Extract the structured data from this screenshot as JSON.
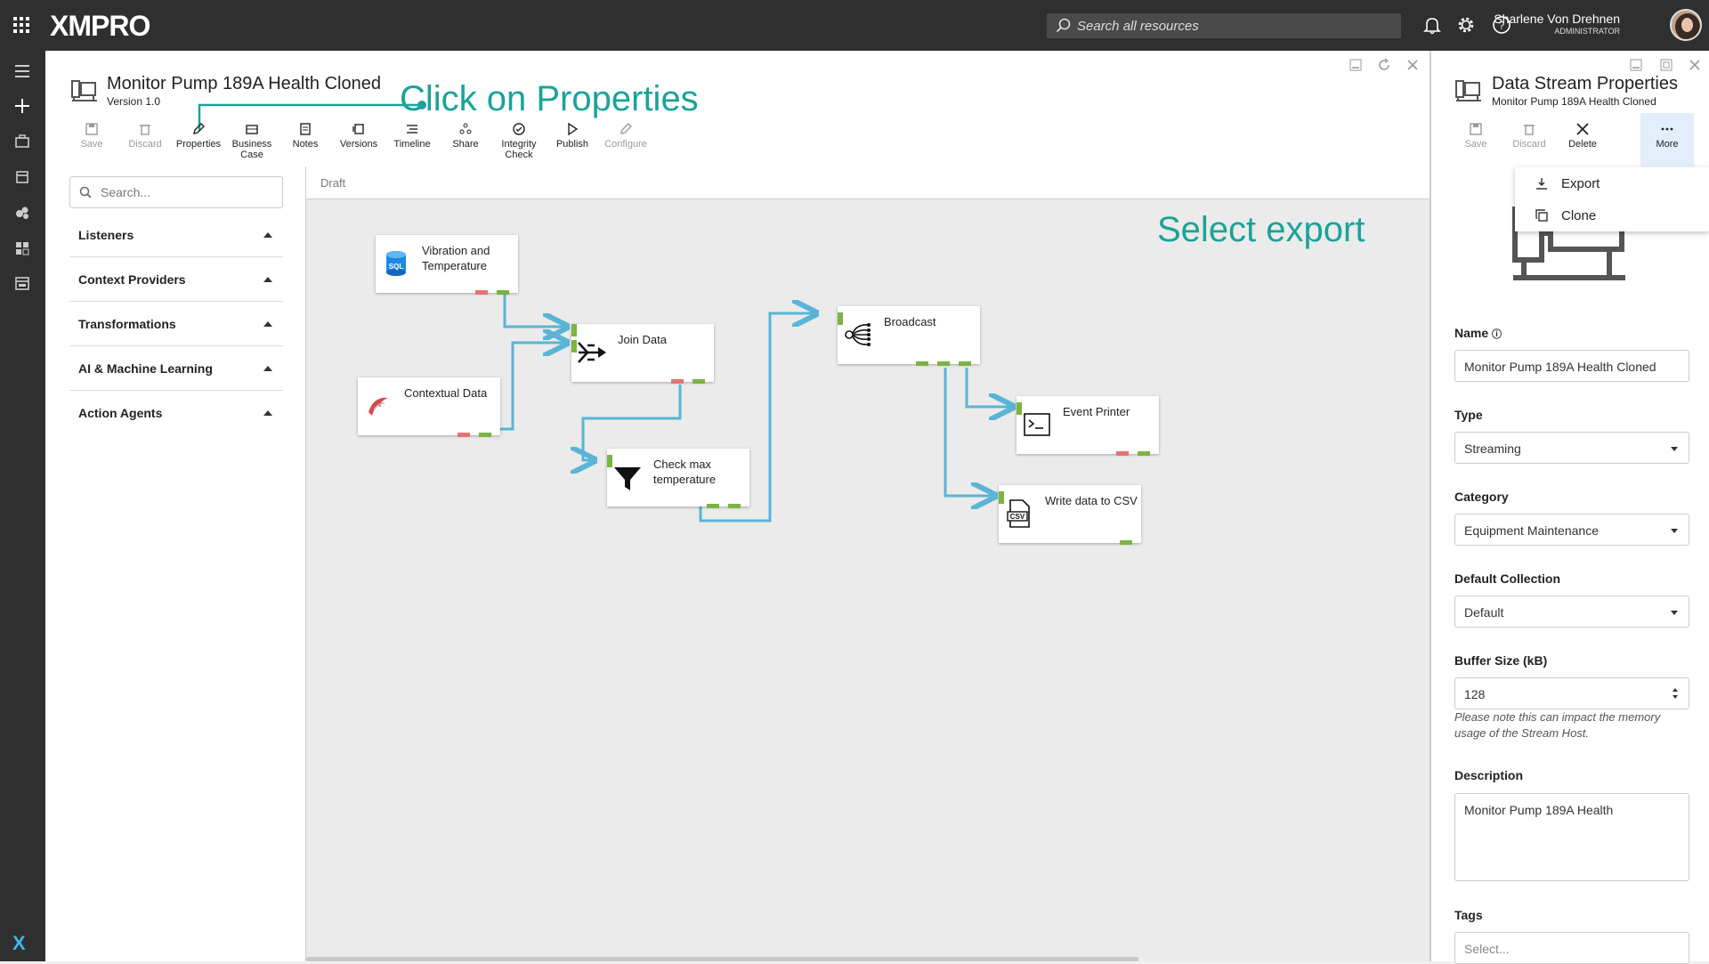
{
  "app": {
    "logo": "XMPRO",
    "search_placeholder": "Search all resources",
    "user_name": "Sharlene Von Drehnen",
    "user_role": "ADMINISTRATOR"
  },
  "left_rail": {
    "icons": [
      "menu-icon",
      "add-icon",
      "briefcase-icon",
      "calendar-icon",
      "stream-icon",
      "dashboard-icon",
      "app-icon"
    ],
    "bottom_logo": "X"
  },
  "stream": {
    "title": "Monitor Pump 189A Health Cloned",
    "version": "Version 1.0"
  },
  "toolbar": [
    {
      "label": "Save",
      "icon": "save-icon",
      "enabled": false
    },
    {
      "label": "Discard",
      "icon": "trash-icon",
      "enabled": false
    },
    {
      "label": "Properties",
      "icon": "pencil-icon",
      "enabled": true
    },
    {
      "label": "Business Case",
      "icon": "case-icon",
      "enabled": true
    },
    {
      "label": "Notes",
      "icon": "notes-icon",
      "enabled": true
    },
    {
      "label": "Versions",
      "icon": "versions-icon",
      "enabled": true
    },
    {
      "label": "Timeline",
      "icon": "timeline-icon",
      "enabled": true
    },
    {
      "label": "Share",
      "icon": "share-icon",
      "enabled": true
    },
    {
      "label": "Integrity Check",
      "icon": "check-circle-icon",
      "enabled": true
    },
    {
      "label": "Publish",
      "icon": "play-icon",
      "enabled": true
    },
    {
      "label": "Configure",
      "icon": "pencil-icon",
      "enabled": false
    }
  ],
  "annotations": {
    "properties_hint": "Click on Properties",
    "export_hint": "Select export"
  },
  "palette": {
    "search_placeholder": "Search...",
    "categories": [
      "Listeners",
      "Context Providers",
      "Transformations",
      "AI & Machine Learning",
      "Action Agents"
    ]
  },
  "canvas": {
    "status": "Draft",
    "nodes": [
      {
        "id": "vibration",
        "label": "Vibration and Temperature",
        "icon": "sql-database-icon"
      },
      {
        "id": "contextual",
        "label": "Contextual Data",
        "icon": "sql-server-icon"
      },
      {
        "id": "join",
        "label": "Join Data",
        "icon": "join-icon"
      },
      {
        "id": "check",
        "label": "Check max temperature",
        "icon": "filter-icon"
      },
      {
        "id": "broadcast",
        "label": "Broadcast",
        "icon": "broadcast-icon"
      },
      {
        "id": "printer",
        "label": "Event Printer",
        "icon": "terminal-icon"
      },
      {
        "id": "csv",
        "label": "Write data to CSV",
        "icon": "csv-file-icon"
      }
    ],
    "wire_color": "#5ab4d6"
  },
  "properties_panel": {
    "title": "Data Stream Properties",
    "subtitle": "Monitor Pump 189A Health Cloned",
    "buttons": [
      {
        "label": "Save",
        "enabled": false
      },
      {
        "label": "Discard",
        "enabled": false
      },
      {
        "label": "Delete",
        "enabled": true
      },
      {
        "label": "More",
        "enabled": true
      }
    ],
    "more_menu": [
      {
        "label": "Export",
        "icon": "download-icon"
      },
      {
        "label": "Clone",
        "icon": "copy-icon"
      }
    ],
    "fields": {
      "name_label": "Name",
      "name_value": "Monitor Pump 189A Health Cloned",
      "type_label": "Type",
      "type_value": "Streaming",
      "category_label": "Category",
      "category_value": "Equipment Maintenance",
      "collection_label": "Default Collection",
      "collection_value": "Default",
      "buffer_label": "Buffer Size (kB)",
      "buffer_value": "128",
      "buffer_note": "Please note this can impact the memory usage of the Stream Host.",
      "description_label": "Description",
      "description_value": "Monitor Pump 189A Health",
      "tags_label": "Tags",
      "tags_placeholder": "Select..."
    }
  },
  "colors": {
    "accent": "#1aa39a",
    "topbar": "#2f2f2f",
    "port_green": "#7cb342",
    "port_red": "#e57373"
  }
}
